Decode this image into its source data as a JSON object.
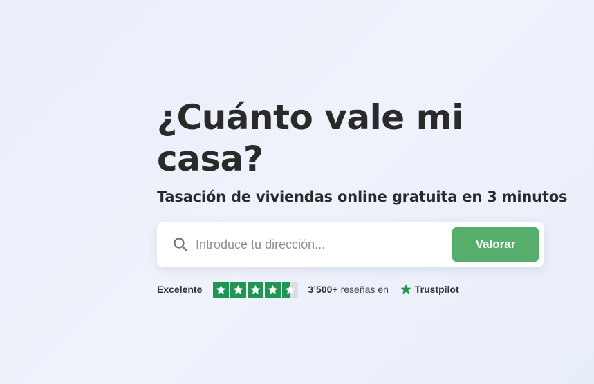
{
  "hero": {
    "title": "¿Cuánto vale mi casa?",
    "subtitle": "Tasación de viviendas online gratuita en 3 minutos"
  },
  "search": {
    "placeholder": "Introduce tu dirección...",
    "value": "",
    "icon": "search-icon",
    "button_label": "Valorar"
  },
  "rating": {
    "label": "Excelente",
    "stars": 4.5,
    "stars_max": 5,
    "review_count": "3’500+",
    "review_text": "reseñas en",
    "platform": "Trustpilot"
  },
  "colors": {
    "accent_button": "#56ad6c",
    "trustpilot_green": "#219653",
    "background": "#eaeffa"
  }
}
